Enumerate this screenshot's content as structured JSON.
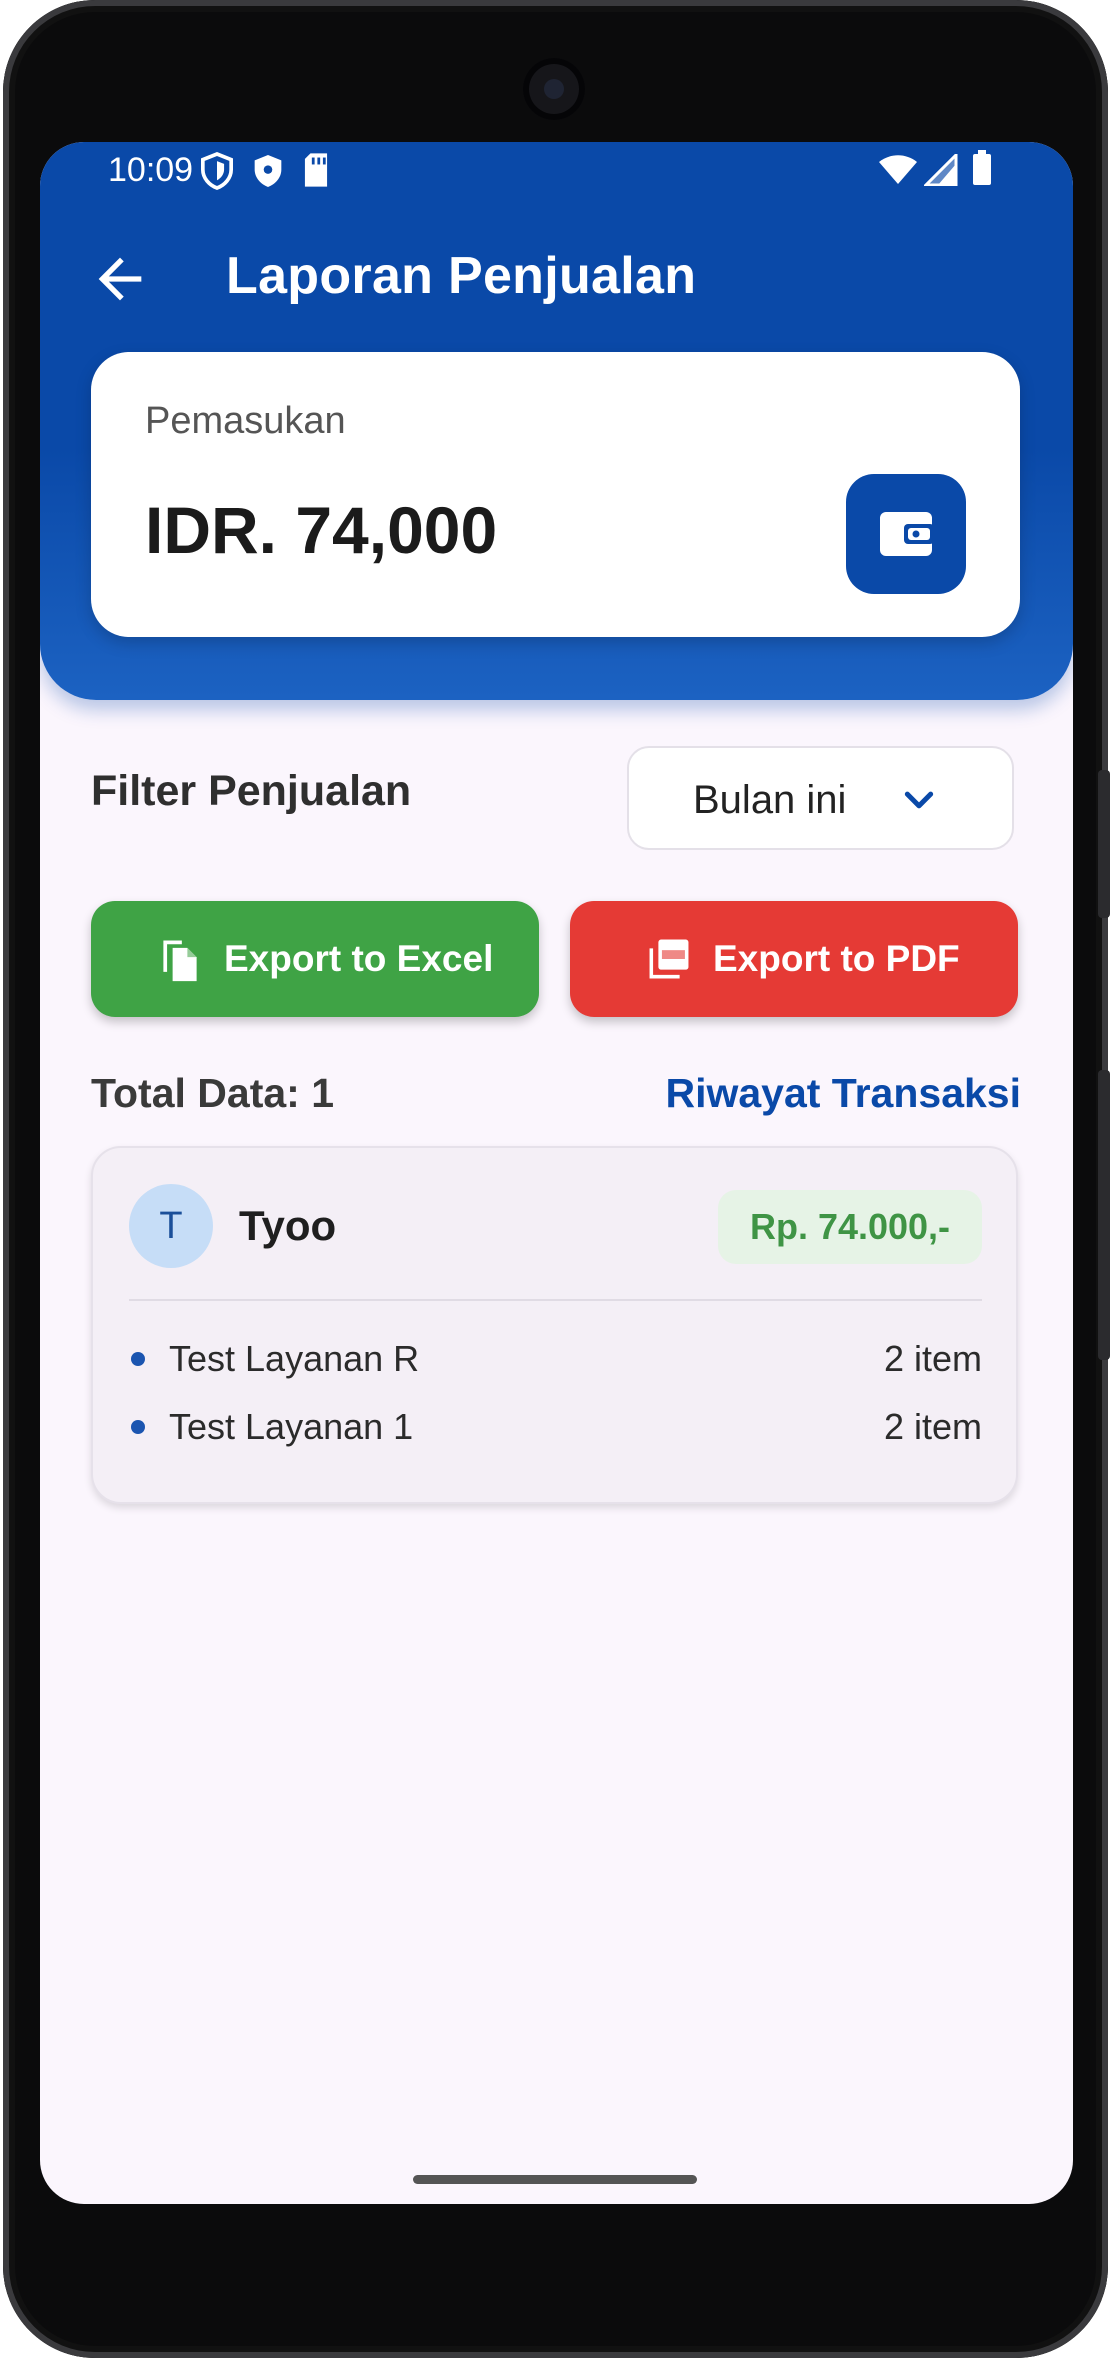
{
  "status_bar": {
    "time": "10:09"
  },
  "header": {
    "title": "Laporan Penjualan"
  },
  "income": {
    "label": "Pemasukan",
    "value": "IDR. 74,000"
  },
  "filter": {
    "label": "Filter Penjualan",
    "selected": "Bulan ini"
  },
  "export": {
    "excel_label": "Export to Excel",
    "pdf_label": "Export to PDF"
  },
  "summary": {
    "total_label": "Total Data: 1",
    "history_link": "Riwayat Transaksi"
  },
  "transactions": [
    {
      "avatar_initial": "T",
      "customer": "Tyoo",
      "amount": "Rp. 74.000,-",
      "items": [
        {
          "name": "Test Layanan R",
          "qty": "2 item"
        },
        {
          "name": "Test Layanan 1",
          "qty": "2 item"
        }
      ]
    }
  ],
  "colors": {
    "primary": "#0a49a8",
    "excel_green": "#3fa345",
    "pdf_red": "#e53a35",
    "background": "#fbf6fd"
  },
  "icons": [
    "arrow-back-icon",
    "wallet-icon",
    "chevron-down-icon",
    "file-copy-icon",
    "pdf-icon",
    "shield-icon",
    "security-icon",
    "sd-card-icon",
    "wifi-icon",
    "signal-icon",
    "battery-icon"
  ]
}
